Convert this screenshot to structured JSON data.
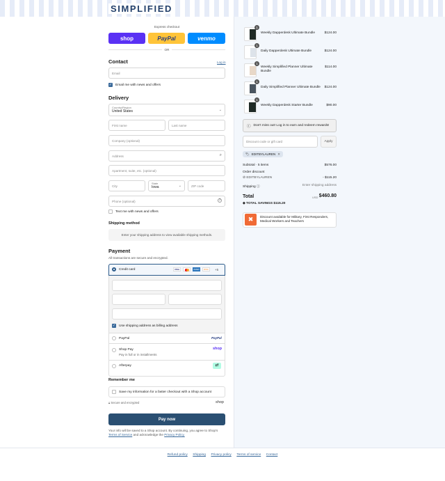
{
  "brand": "SIMPLIFIED",
  "express": {
    "title": "Express checkout",
    "shop": "shop",
    "paypal": "PayPal",
    "venmo": "venmo",
    "or": "OR"
  },
  "contact": {
    "title": "Contact",
    "login": "Log in",
    "email_placeholder": "Email",
    "news": "Email me with news and offers"
  },
  "delivery": {
    "title": "Delivery",
    "country_label": "Country/Region",
    "country_value": "United States",
    "first": "First name",
    "last": "Last name",
    "company": "Company (optional)",
    "address": "Address",
    "apt": "Apartment, suite, etc. (optional)",
    "city": "City",
    "state_label": "State",
    "state_value": "Iowa",
    "zip": "ZIP code",
    "phone": "Phone (optional)",
    "text_news": "Text me with news and offers"
  },
  "shipping": {
    "title": "Shipping method",
    "note": "Enter your shipping address to view available shipping methods."
  },
  "payment": {
    "title": "Payment",
    "subtitle": "All transactions are secure and encrypted.",
    "credit_card": "Credit card",
    "card_brands": [
      "VISA",
      "MC",
      "AMEX",
      "DISC"
    ],
    "more": "+5",
    "billing_same": "Use shipping address as billing address",
    "paypal": "PayPal",
    "paypal_logo": "PayPal",
    "shoppay": "Shop Pay",
    "shoppay_sub": "Pay in full or in installments",
    "shoppay_logo": "shop",
    "afterpay": "Afterpay"
  },
  "remember": {
    "title": "Remember me",
    "save": "Save my information for a faster checkout with a Shop account",
    "secure": "Secure and encrypted",
    "shop_logo": "shop"
  },
  "pay_button": "Pay now",
  "legal": {
    "text1": "Your info will be saved to a Shop account. By continuing, you agree to Shop's",
    "terms": "Terms of Service",
    "and": "and acknowledge the",
    "privacy": "Privacy Policy."
  },
  "footer": [
    "Refund policy",
    "Shipping",
    "Privacy policy",
    "Terms of service",
    "Contact"
  ],
  "cart": {
    "items": [
      {
        "qty": "1",
        "name": "Weekly Dapperdesk Ultimate Bundle",
        "price": "$124.00"
      },
      {
        "qty": "1",
        "name": "Daily Dapperdesk Ultimate Bundle",
        "price": "$124.00"
      },
      {
        "qty": "1",
        "name": "Weekly Simplified Planner Ultimate Bundle",
        "price": "$114.00"
      },
      {
        "qty": "1",
        "name": "Daily Simplified Planner Ultimate Bundle",
        "price": "$124.00"
      },
      {
        "qty": "1",
        "name": "Weekly Dapperdesk Starter Bundle",
        "price": "$90.00"
      }
    ],
    "rewards": "Don't miss out! Log in to earn and redeem rewards!",
    "discount_placeholder": "Discount code or gift card",
    "apply": "Apply",
    "code_tag": "EDITBYLAUREN",
    "subtotal_label": "Subtotal · 5 items",
    "subtotal": "$576.00",
    "order_discount": "Order discount",
    "discount_code": "EDITBYLAUREN",
    "discount_value": "- $115.20",
    "shipping_label": "Shipping",
    "shipping_value": "Enter shipping address",
    "total_label": "Total",
    "currency": "USD",
    "total": "$460.80",
    "savings": "TOTAL SAVINGS  $115.20",
    "military": "Discount available for Military, First Responders, Medical Workers and Teachers"
  },
  "colors": {
    "accent": "#23406b",
    "shop": "#5a31f4",
    "paypal": "#ffc439",
    "venmo": "#008cff",
    "pay_button": "#2a4f72"
  }
}
